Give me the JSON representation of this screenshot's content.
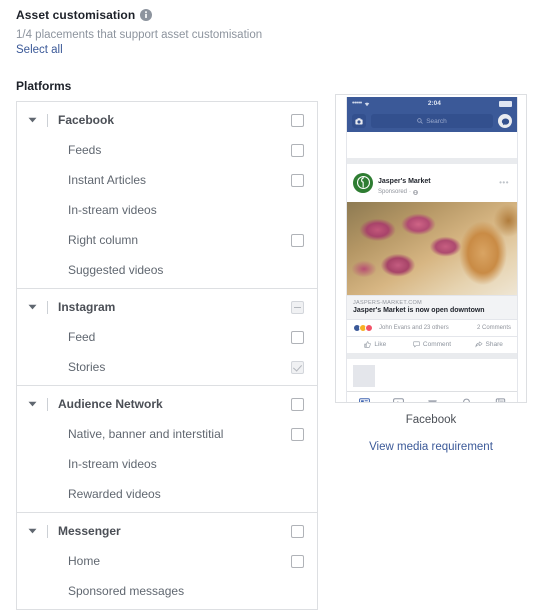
{
  "header": {
    "title": "Asset customisation",
    "info_icon": "info-icon",
    "subtitle": "1/4 placements that support asset customisation",
    "select_all_label": "Select all"
  },
  "platforms_label": "Platforms",
  "platform_groups": [
    {
      "name": "Facebook",
      "caret": "caret-down-icon",
      "checkbox_state": "unchecked",
      "children": [
        {
          "name": "Feeds",
          "checkbox_state": "unchecked"
        },
        {
          "name": "Instant Articles",
          "checkbox_state": "unchecked"
        },
        {
          "name": "In-stream videos",
          "checkbox_state": "none"
        },
        {
          "name": "Right column",
          "checkbox_state": "unchecked"
        },
        {
          "name": "Suggested videos",
          "checkbox_state": "none"
        }
      ]
    },
    {
      "name": "Instagram",
      "caret": "caret-down-icon",
      "checkbox_state": "indeterminate",
      "children": [
        {
          "name": "Feed",
          "checkbox_state": "unchecked"
        },
        {
          "name": "Stories",
          "checkbox_state": "checked-disabled"
        }
      ]
    },
    {
      "name": "Audience Network",
      "caret": "caret-down-icon",
      "checkbox_state": "unchecked",
      "children": [
        {
          "name": "Native, banner and interstitial",
          "checkbox_state": "unchecked"
        },
        {
          "name": "In-stream videos",
          "checkbox_state": "none"
        },
        {
          "name": "Rewarded videos",
          "checkbox_state": "none"
        }
      ]
    },
    {
      "name": "Messenger",
      "caret": "caret-down-icon",
      "checkbox_state": "unchecked",
      "children": [
        {
          "name": "Home",
          "checkbox_state": "unchecked"
        },
        {
          "name": "Sponsored messages",
          "checkbox_state": "none"
        }
      ]
    }
  ],
  "preview": {
    "caption": "Facebook",
    "media_requirement_link": "View media requirement",
    "phone": {
      "status_bar": {
        "signal": "•••••",
        "wifi_icon": "wifi-icon",
        "time": "2:04",
        "battery_icon": "battery-icon"
      },
      "nav": {
        "camera_icon": "camera-icon",
        "search_placeholder": "Search",
        "search_icon": "search-icon",
        "messenger_icon": "messenger-icon"
      },
      "post": {
        "page_name": "Jasper's Market",
        "sponsored_label": "Sponsored",
        "separator": "·",
        "globe_icon": "globe-icon",
        "more_icon": "more-options-icon",
        "image_alt": "fig-tart-photo",
        "link_domain": "JASPERS-MARKET.COM",
        "headline": "Jasper's Market is now open downtown",
        "reactions": [
          "like-reaction-icon",
          "haha-reaction-icon",
          "love-reaction-icon"
        ],
        "reactions_text": "John Evans and 23 others",
        "comments_text": "2 Comments",
        "actions": [
          {
            "label": "Like",
            "icon": "thumbs-up-icon"
          },
          {
            "label": "Comment",
            "icon": "comment-bubble-icon"
          },
          {
            "label": "Share",
            "icon": "share-arrow-icon"
          }
        ]
      },
      "tabbar": [
        "news-feed-icon",
        "watch-video-icon",
        "marketplace-icon",
        "notifications-bell-icon",
        "menu-icon"
      ]
    }
  },
  "colors": {
    "facebook_blue": "#3b5998",
    "link_blue": "#3b5998",
    "border": "#dddfe2",
    "text_primary": "#1d2129",
    "text_secondary": "#606770",
    "text_muted": "#8d949e"
  }
}
